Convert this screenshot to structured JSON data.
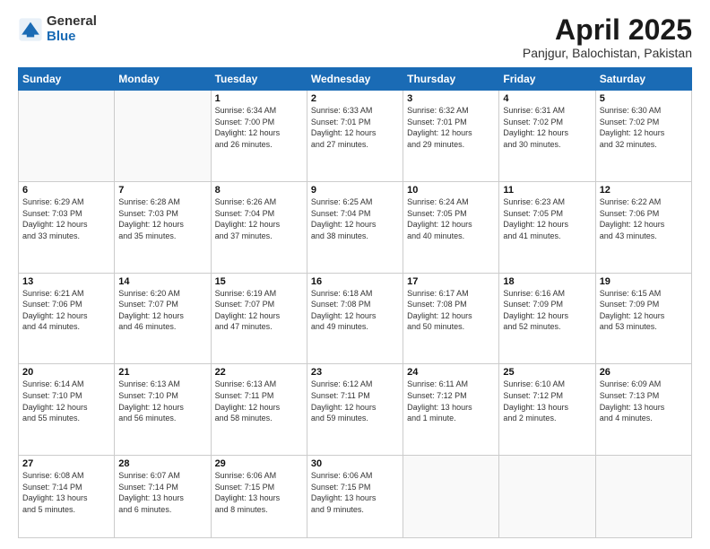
{
  "logo": {
    "general": "General",
    "blue": "Blue"
  },
  "header": {
    "title": "April 2025",
    "subtitle": "Panjgur, Balochistan, Pakistan"
  },
  "weekdays": [
    "Sunday",
    "Monday",
    "Tuesday",
    "Wednesday",
    "Thursday",
    "Friday",
    "Saturday"
  ],
  "weeks": [
    [
      {
        "day": "",
        "info": ""
      },
      {
        "day": "",
        "info": ""
      },
      {
        "day": "1",
        "info": "Sunrise: 6:34 AM\nSunset: 7:00 PM\nDaylight: 12 hours\nand 26 minutes."
      },
      {
        "day": "2",
        "info": "Sunrise: 6:33 AM\nSunset: 7:01 PM\nDaylight: 12 hours\nand 27 minutes."
      },
      {
        "day": "3",
        "info": "Sunrise: 6:32 AM\nSunset: 7:01 PM\nDaylight: 12 hours\nand 29 minutes."
      },
      {
        "day": "4",
        "info": "Sunrise: 6:31 AM\nSunset: 7:02 PM\nDaylight: 12 hours\nand 30 minutes."
      },
      {
        "day": "5",
        "info": "Sunrise: 6:30 AM\nSunset: 7:02 PM\nDaylight: 12 hours\nand 32 minutes."
      }
    ],
    [
      {
        "day": "6",
        "info": "Sunrise: 6:29 AM\nSunset: 7:03 PM\nDaylight: 12 hours\nand 33 minutes."
      },
      {
        "day": "7",
        "info": "Sunrise: 6:28 AM\nSunset: 7:03 PM\nDaylight: 12 hours\nand 35 minutes."
      },
      {
        "day": "8",
        "info": "Sunrise: 6:26 AM\nSunset: 7:04 PM\nDaylight: 12 hours\nand 37 minutes."
      },
      {
        "day": "9",
        "info": "Sunrise: 6:25 AM\nSunset: 7:04 PM\nDaylight: 12 hours\nand 38 minutes."
      },
      {
        "day": "10",
        "info": "Sunrise: 6:24 AM\nSunset: 7:05 PM\nDaylight: 12 hours\nand 40 minutes."
      },
      {
        "day": "11",
        "info": "Sunrise: 6:23 AM\nSunset: 7:05 PM\nDaylight: 12 hours\nand 41 minutes."
      },
      {
        "day": "12",
        "info": "Sunrise: 6:22 AM\nSunset: 7:06 PM\nDaylight: 12 hours\nand 43 minutes."
      }
    ],
    [
      {
        "day": "13",
        "info": "Sunrise: 6:21 AM\nSunset: 7:06 PM\nDaylight: 12 hours\nand 44 minutes."
      },
      {
        "day": "14",
        "info": "Sunrise: 6:20 AM\nSunset: 7:07 PM\nDaylight: 12 hours\nand 46 minutes."
      },
      {
        "day": "15",
        "info": "Sunrise: 6:19 AM\nSunset: 7:07 PM\nDaylight: 12 hours\nand 47 minutes."
      },
      {
        "day": "16",
        "info": "Sunrise: 6:18 AM\nSunset: 7:08 PM\nDaylight: 12 hours\nand 49 minutes."
      },
      {
        "day": "17",
        "info": "Sunrise: 6:17 AM\nSunset: 7:08 PM\nDaylight: 12 hours\nand 50 minutes."
      },
      {
        "day": "18",
        "info": "Sunrise: 6:16 AM\nSunset: 7:09 PM\nDaylight: 12 hours\nand 52 minutes."
      },
      {
        "day": "19",
        "info": "Sunrise: 6:15 AM\nSunset: 7:09 PM\nDaylight: 12 hours\nand 53 minutes."
      }
    ],
    [
      {
        "day": "20",
        "info": "Sunrise: 6:14 AM\nSunset: 7:10 PM\nDaylight: 12 hours\nand 55 minutes."
      },
      {
        "day": "21",
        "info": "Sunrise: 6:13 AM\nSunset: 7:10 PM\nDaylight: 12 hours\nand 56 minutes."
      },
      {
        "day": "22",
        "info": "Sunrise: 6:13 AM\nSunset: 7:11 PM\nDaylight: 12 hours\nand 58 minutes."
      },
      {
        "day": "23",
        "info": "Sunrise: 6:12 AM\nSunset: 7:11 PM\nDaylight: 12 hours\nand 59 minutes."
      },
      {
        "day": "24",
        "info": "Sunrise: 6:11 AM\nSunset: 7:12 PM\nDaylight: 13 hours\nand 1 minute."
      },
      {
        "day": "25",
        "info": "Sunrise: 6:10 AM\nSunset: 7:12 PM\nDaylight: 13 hours\nand 2 minutes."
      },
      {
        "day": "26",
        "info": "Sunrise: 6:09 AM\nSunset: 7:13 PM\nDaylight: 13 hours\nand 4 minutes."
      }
    ],
    [
      {
        "day": "27",
        "info": "Sunrise: 6:08 AM\nSunset: 7:14 PM\nDaylight: 13 hours\nand 5 minutes."
      },
      {
        "day": "28",
        "info": "Sunrise: 6:07 AM\nSunset: 7:14 PM\nDaylight: 13 hours\nand 6 minutes."
      },
      {
        "day": "29",
        "info": "Sunrise: 6:06 AM\nSunset: 7:15 PM\nDaylight: 13 hours\nand 8 minutes."
      },
      {
        "day": "30",
        "info": "Sunrise: 6:06 AM\nSunset: 7:15 PM\nDaylight: 13 hours\nand 9 minutes."
      },
      {
        "day": "",
        "info": ""
      },
      {
        "day": "",
        "info": ""
      },
      {
        "day": "",
        "info": ""
      }
    ]
  ]
}
